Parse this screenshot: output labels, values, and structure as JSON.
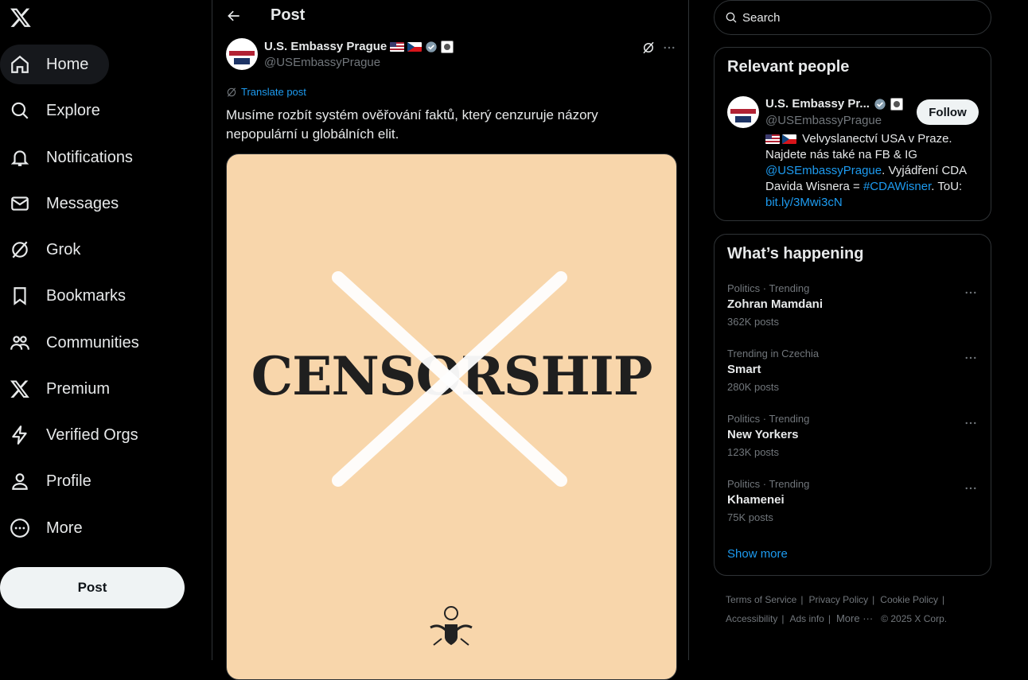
{
  "nav": {
    "items": [
      {
        "label": "Home",
        "icon": "home-icon"
      },
      {
        "label": "Explore",
        "icon": "search-icon"
      },
      {
        "label": "Notifications",
        "icon": "bell-icon"
      },
      {
        "label": "Messages",
        "icon": "envelope-icon"
      },
      {
        "label": "Grok",
        "icon": "grok-icon"
      },
      {
        "label": "Bookmarks",
        "icon": "bookmark-icon"
      },
      {
        "label": "Communities",
        "icon": "people-icon"
      },
      {
        "label": "Premium",
        "icon": "x-logo-icon"
      },
      {
        "label": "Verified Orgs",
        "icon": "lightning-icon"
      },
      {
        "label": "Profile",
        "icon": "person-icon"
      },
      {
        "label": "More",
        "icon": "more-circle-icon"
      }
    ],
    "post_button": "Post"
  },
  "post": {
    "header_title": "Post",
    "author_name": "U.S. Embassy Prague",
    "author_handle": "@USEmbassyPrague",
    "translate_label": "Translate post",
    "text": "Musíme rozbít systém ověřování faktů, který cenzuruje názory nepopulární u globálních elit.",
    "image_text": "CENSORSHIP"
  },
  "search": {
    "placeholder": "Search"
  },
  "relevant": {
    "title": "Relevant people",
    "name": "U.S. Embassy Pr...",
    "handle": "@USEmbassyPrague",
    "follow_label": "Follow",
    "bio_1": "Velvyslanectví USA v Praze. Najdete nás také na FB & IG",
    "bio_mention": "@USEmbassyPrague",
    "bio_2": ". Vyjádření CDA Davida Wisnera = ",
    "bio_hashtag": "#CDAWisner",
    "bio_3": ". ToU:",
    "bio_link": "bit.ly/3Mwi3cN"
  },
  "happening": {
    "title": "What’s happening",
    "trends": [
      {
        "meta": "Politics · Trending",
        "name": "Zohran Mamdani",
        "count": "362K posts"
      },
      {
        "meta": "Trending in Czechia",
        "name": "Smart",
        "count": "280K posts"
      },
      {
        "meta": "Politics · Trending",
        "name": "New Yorkers",
        "count": "123K posts"
      },
      {
        "meta": "Politics · Trending",
        "name": "Khamenei",
        "count": "75K posts"
      }
    ],
    "show_more": "Show more"
  },
  "footer": {
    "links": [
      "Terms of Service",
      "Privacy Policy",
      "Cookie Policy",
      "Accessibility",
      "Ads info",
      "More ···"
    ],
    "copyright": "© 2025 X Corp."
  },
  "colors": {
    "background": "#000000",
    "accent": "#1d9bf0",
    "image_background": "#f8d6ab",
    "border": "#2f3336"
  }
}
